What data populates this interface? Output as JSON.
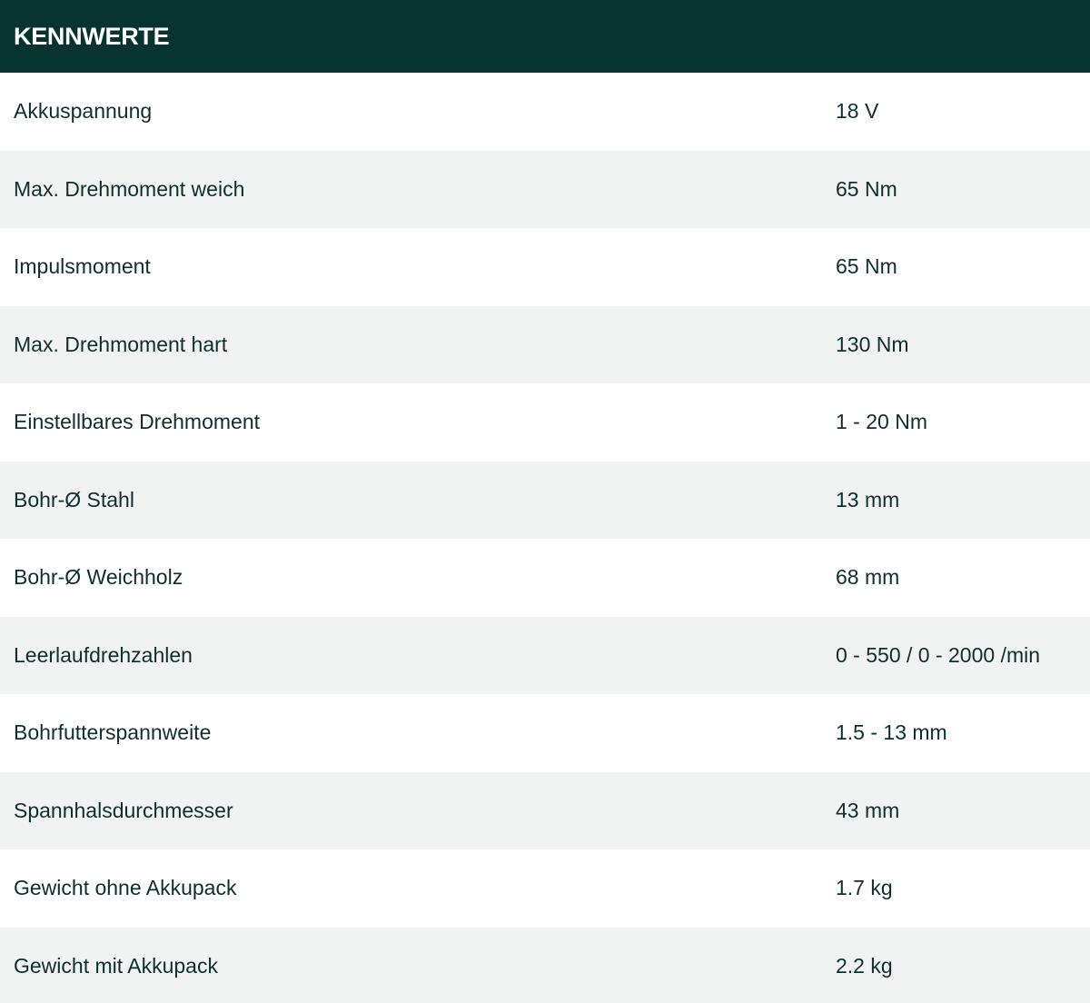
{
  "header": {
    "title": "KENNWERTE"
  },
  "specs": [
    {
      "label": "Akkuspannung",
      "value": "18 V"
    },
    {
      "label": "Max. Drehmoment weich",
      "value": "65 Nm"
    },
    {
      "label": "Impulsmoment",
      "value": "65 Nm"
    },
    {
      "label": "Max. Drehmoment hart",
      "value": "130 Nm"
    },
    {
      "label": "Einstellbares Drehmoment",
      "value": "1 - 20 Nm"
    },
    {
      "label": "Bohr-Ø Stahl",
      "value": "13 mm"
    },
    {
      "label": "Bohr-Ø Weichholz",
      "value": "68 mm"
    },
    {
      "label": "Leerlaufdrehzahlen",
      "value": "0 - 550 / 0 - 2000 /min"
    },
    {
      "label": "Bohrfutterspannweite",
      "value": "1.5 - 13 mm"
    },
    {
      "label": "Spannhalsdurchmesser",
      "value": "43 mm"
    },
    {
      "label": "Gewicht ohne Akkupack",
      "value": "1.7 kg"
    },
    {
      "label": "Gewicht mit Akkupack",
      "value": "2.2 kg"
    }
  ],
  "colors": {
    "header_bg": "#08342f",
    "row_alt_bg": "#f1f3f2",
    "text": "#0e2f2b"
  }
}
